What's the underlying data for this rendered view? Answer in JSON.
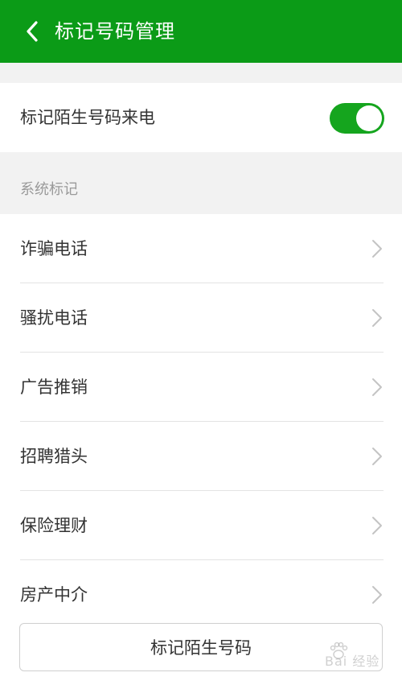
{
  "header": {
    "title": "标记号码管理",
    "back_icon": "chevron-left-icon",
    "background": "#0b9b17"
  },
  "toggle": {
    "label": "标记陌生号码来电",
    "enabled": true,
    "color": "#15a51e"
  },
  "section": {
    "label": "系统标记"
  },
  "items": [
    {
      "label": "诈骗电话",
      "icon": "chevron-right-icon"
    },
    {
      "label": "骚扰电话",
      "icon": "chevron-right-icon"
    },
    {
      "label": "广告推销",
      "icon": "chevron-right-icon"
    },
    {
      "label": "招聘猎头",
      "icon": "chevron-right-icon"
    },
    {
      "label": "保险理财",
      "icon": "chevron-right-icon"
    },
    {
      "label": "房产中介",
      "icon": "chevron-right-icon"
    }
  ],
  "bottom_button": {
    "label": "标记陌生号码"
  },
  "watermark": {
    "text": "Bai 经验"
  }
}
